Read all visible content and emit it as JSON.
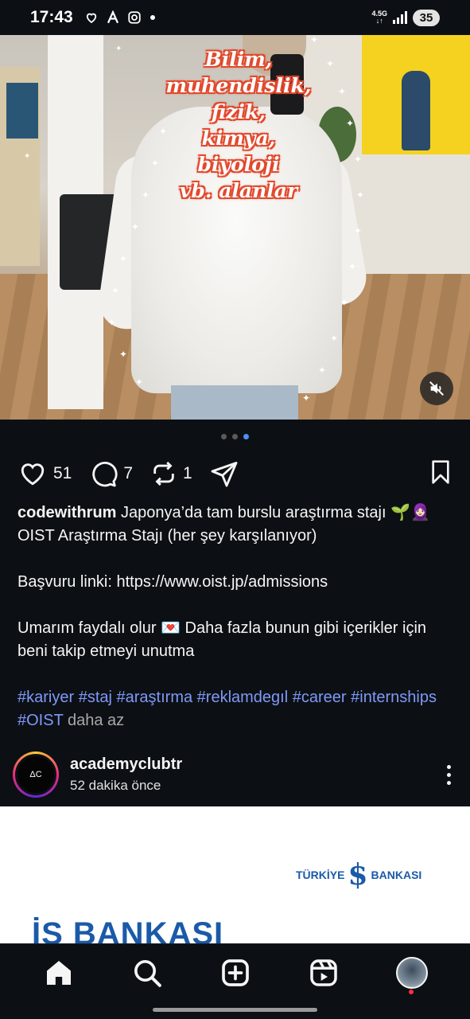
{
  "status_bar": {
    "time": "17:43",
    "network": "4.5G",
    "battery": "35",
    "icons": [
      "heart-outline-icon",
      "a-logo-icon",
      "instagram-icon",
      "dot-icon",
      "signal-icon"
    ]
  },
  "post": {
    "media": {
      "sticker_lines": [
        "Bilim,",
        "muhendislik,",
        "fizik,",
        "kimya,",
        "biyoloji",
        "vb. alanlar"
      ],
      "mute_icon": "speaker-muted-icon"
    },
    "carousel": {
      "count": 3,
      "active_index": 2
    },
    "actions": {
      "likes": "51",
      "comments": "7",
      "reposts": "1"
    },
    "caption": {
      "username": "codewithrum",
      "line1": "Japonya’da tam burslu araştırma stajı 🌱🧕🏻",
      "line2": "OIST Araştırma Stajı (her şey karşılanıyor)",
      "line3": "Başvuru linki: https://www.oist.jp/admissions",
      "line4": "Umarım faydalı olur 💌 Daha fazla bunun gibi içerikler için beni takip etmeyi unutma",
      "hashtags": [
        "#kariyer",
        "#staj",
        "#araştırma",
        "#reklamdegıl",
        "#career",
        "#internships",
        "#OIST"
      ],
      "less_link": "daha az"
    }
  },
  "next_post": {
    "avatar_text": "ΔC",
    "username": "academyclubtr",
    "time": "52 dakika önce",
    "ad": {
      "brand_name": "TÜRKİYE",
      "brand_mark": "$",
      "brand_suffix": "BANKASI",
      "headline": "İŞ BANKASI"
    }
  },
  "bottom_nav": {
    "items": [
      "home-icon",
      "search-icon",
      "create-post-icon",
      "reels-icon",
      "profile-avatar"
    ]
  },
  "colors": {
    "background": "#0c1014",
    "hashtag": "#7f99f8",
    "active_dot": "#4d8df5",
    "brand_blue": "#1a5aa8"
  }
}
